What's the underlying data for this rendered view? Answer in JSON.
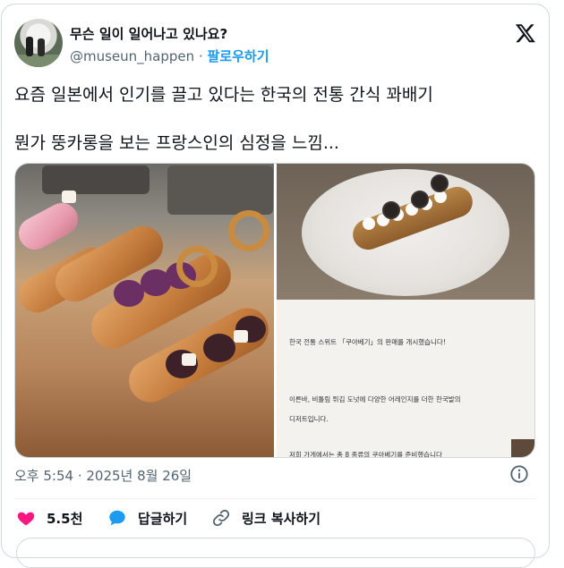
{
  "tweet": {
    "author_name": "무슨 일이 일어나고 있나요?",
    "handle": "@museun_happen",
    "separator": "·",
    "follow_label": "팔로우하기",
    "lines": [
      "요즘 일본에서 인기를 끌고 있다는 한국의 전통 간식 꽈배기",
      "뭔가 뚱카롱을 보는 프랑스인의 심정을 느낌..."
    ],
    "timestamp": "오후 5:54 · 2025년 8월 26일"
  },
  "media": {
    "caption_lines": [
      "한국 전통 스위트 「쿠아베기」의 판매를 개시했습니다!",
      "이른바, 비틀림 튀김 도넛에 다양한 어레인지를 더한 한국발의",
      "디저트입니다.",
      "저희 가게에서는 총 8 종류의 쿠아베기를 준비했습니다"
    ]
  },
  "actions": {
    "like_count": "5.5천",
    "reply_label": "답글하기",
    "copy_link_label": "링크 복사하기"
  },
  "icons": {
    "logo": "x-logo-icon",
    "info": "info-icon",
    "like": "heart-icon",
    "reply": "reply-bubble-icon",
    "link": "link-icon"
  },
  "colors": {
    "accent": "#1d9bf0",
    "like": "#f91880",
    "text": "#0f1419",
    "secondary": "#536471",
    "border": "#cfd9de"
  }
}
